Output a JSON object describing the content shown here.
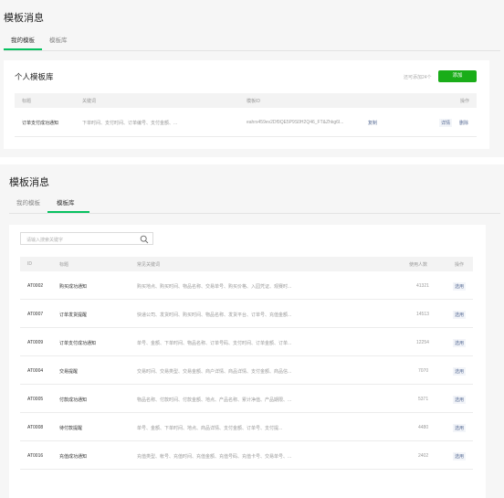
{
  "top": {
    "title": "模板消息",
    "tabs": [
      {
        "label": "我的模板"
      },
      {
        "label": "模板库"
      }
    ],
    "card_title": "个人模板库",
    "quota": "还可添加24个",
    "add_label": "添加",
    "headers": {
      "title": "标题",
      "keywords": "关键词",
      "template_id": "模板ID",
      "actions": "操作"
    },
    "rows": [
      {
        "title": "订单支付成功通知",
        "keywords": "下单时间、支付时间、订单编号、支付金额、...",
        "template_id": "eahrs459ev2Df9QE5P9S0H2Q46_FT&Zhkg6I...",
        "copy": "复制",
        "detail": "详情",
        "delete": "删除"
      }
    ]
  },
  "bottom": {
    "title": "模板消息",
    "tabs": [
      {
        "label": "我的模板"
      },
      {
        "label": "模板库"
      }
    ],
    "search_placeholder": "请输入搜索关键字",
    "headers": {
      "id": "ID",
      "title": "标题",
      "keywords": "常见关键词",
      "usage": "使用人数",
      "action": "操作"
    },
    "rows": [
      {
        "id": "AT0002",
        "title": "购买成功通知",
        "keywords": "购买地点、购买时间、物品名称、交易单号、购买价格、入园凭证、观赛时...",
        "usage": "41321",
        "action": "选用"
      },
      {
        "id": "AT0007",
        "title": "订单发货提醒",
        "keywords": "快递公司、发货时间、购买时间、物品名称、发货平台、订单号、充值金额...",
        "usage": "14513",
        "action": "选用"
      },
      {
        "id": "AT0009",
        "title": "订单支付成功通知",
        "keywords": "单号、金额、下单时间、物品名称、订单号码、支付时间、订单金额、订单...",
        "usage": "12254",
        "action": "选用"
      },
      {
        "id": "AT0004",
        "title": "交易提醒",
        "keywords": "交易时间、交易类型、交易金额、商户详情、商品详情、支付金额、商品信...",
        "usage": "7070",
        "action": "选用"
      },
      {
        "id": "AT0005",
        "title": "付款成功通知",
        "keywords": "物品名称、付款时间、付款金额、地点、产品名称、累计净值、产品期限、...",
        "usage": "5371",
        "action": "选用"
      },
      {
        "id": "AT0008",
        "title": "待付款提醒",
        "keywords": "单号、金额、下单时间、地点、商品详情、支付金额、订单号、支付提...",
        "usage": "4480",
        "action": "选用"
      },
      {
        "id": "AT0016",
        "title": "充值成功通知",
        "keywords": "充值类型、帐号、充值时间、充值金额、充值号码、充值卡号、交易单号、...",
        "usage": "2402",
        "action": "选用"
      }
    ]
  },
  "colors": {
    "accent": "#07c160",
    "button": "#1aad19",
    "link": "#576b95"
  }
}
